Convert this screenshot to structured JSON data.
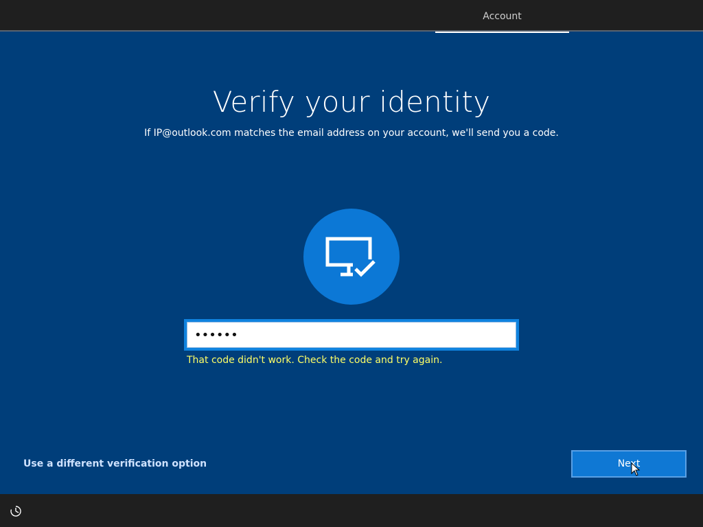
{
  "header": {
    "steps": [
      {
        "label": "Account",
        "active": true
      }
    ]
  },
  "main": {
    "title": "Verify your identity",
    "subtitle": "If IP@outlook.com matches the email address on your account, we'll send you a code.",
    "hero_icon": "pc-check-icon",
    "code_input": {
      "value": "••••••",
      "placeholder": ""
    },
    "error_message": "That code didn't work. Check the code and try again."
  },
  "footer": {
    "alt_option_label": "Use a different verification option",
    "next_label": "Next",
    "ease_of_access_icon": "ease-of-access-icon"
  },
  "colors": {
    "background": "#003e7a",
    "accent": "#0f78d4",
    "error": "#ffff66",
    "bars": "#1f1f1f"
  }
}
